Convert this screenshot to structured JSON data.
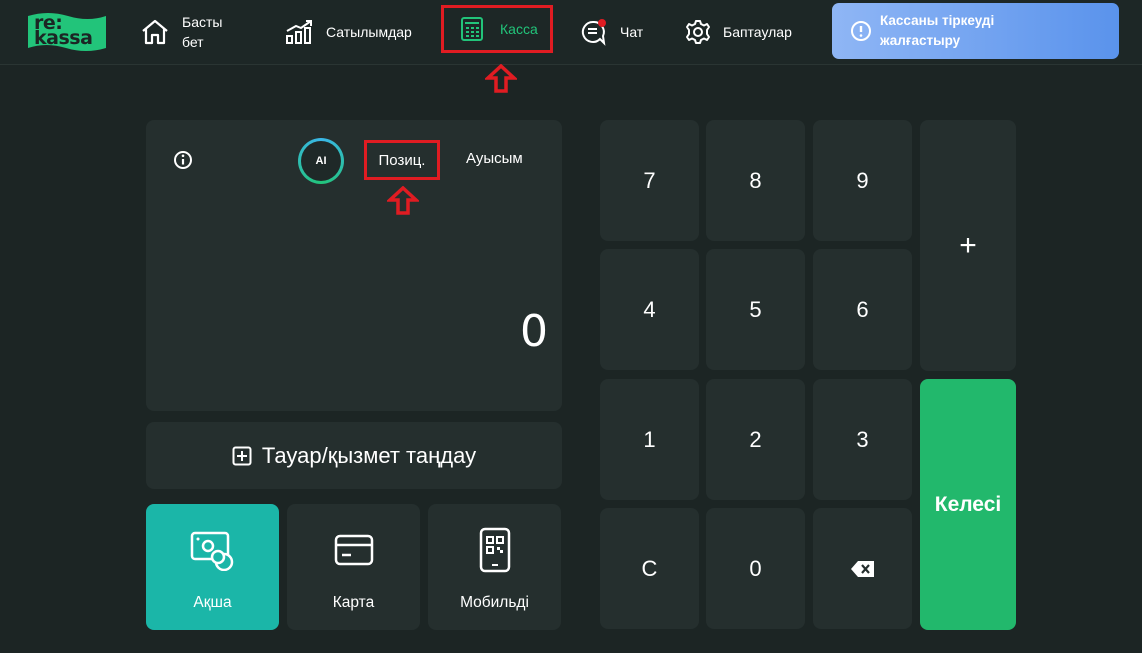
{
  "brand": {
    "logo_text": "re:\nkassa",
    "logo_color": "#22c47a"
  },
  "nav": {
    "home": "Басты\nбет",
    "sales": "Сатылымдар",
    "kassa": "Касса",
    "chat": "Чат",
    "settings": "Баптаулар"
  },
  "warning": {
    "text": "Кассаны тіркеуді\nжалғастыру"
  },
  "display": {
    "ai_label": "AI",
    "positions_tab": "Позиц.",
    "shift_tab": "Ауысым",
    "amount": "0"
  },
  "goods_button": "Тауар/қызмет таңдау",
  "payment": {
    "cash": "Ақша",
    "card": "Карта",
    "mobile": "Мобильді"
  },
  "keypad": {
    "k7": "7",
    "k8": "8",
    "k9": "9",
    "k4": "4",
    "k5": "5",
    "k6": "6",
    "k1": "1",
    "k2": "2",
    "k3": "3",
    "kc": "C",
    "k0": "0",
    "plus": "+",
    "next": "Келесі"
  },
  "colors": {
    "accent_green": "#22c47a",
    "cash_teal": "#1bb6a8",
    "next_green": "#22b86c",
    "highlight_red": "#e01c22"
  },
  "icons": [
    "home-icon",
    "sales-chart-icon",
    "calculator-icon",
    "chat-icon",
    "gear-icon",
    "alert-icon",
    "info-icon",
    "plus-square-icon",
    "cash-icon",
    "card-icon",
    "mobile-qr-icon",
    "backspace-icon"
  ]
}
